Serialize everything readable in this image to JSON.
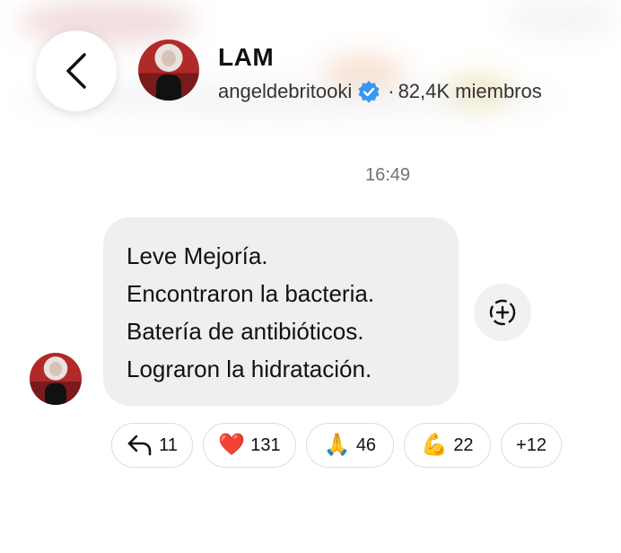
{
  "header": {
    "back_icon": "chevron-left-icon",
    "channel_name": "LAM",
    "username": "angeldebritooki",
    "separator": "·",
    "members": "82,4K miembros",
    "verified_color": "#3897f0"
  },
  "message": {
    "time": "16:49",
    "lines": [
      "Leve Mejoría.",
      "Encontraron la bacteria.",
      "Batería de antibióticos.",
      "Lograron la hidratación."
    ],
    "add_reaction_icon": "add-reaction-icon"
  },
  "reactions": [
    {
      "icon": "reply-arrow-icon",
      "emoji": "",
      "count": "11"
    },
    {
      "icon": "heart-emoji",
      "emoji": "❤️",
      "count": "131"
    },
    {
      "icon": "folded-hands-emoji",
      "emoji": "🙏",
      "count": "46"
    },
    {
      "icon": "flexed-biceps-emoji",
      "emoji": "💪",
      "count": "22"
    },
    {
      "icon": "more-reactions",
      "emoji": "",
      "count": "+12"
    }
  ]
}
